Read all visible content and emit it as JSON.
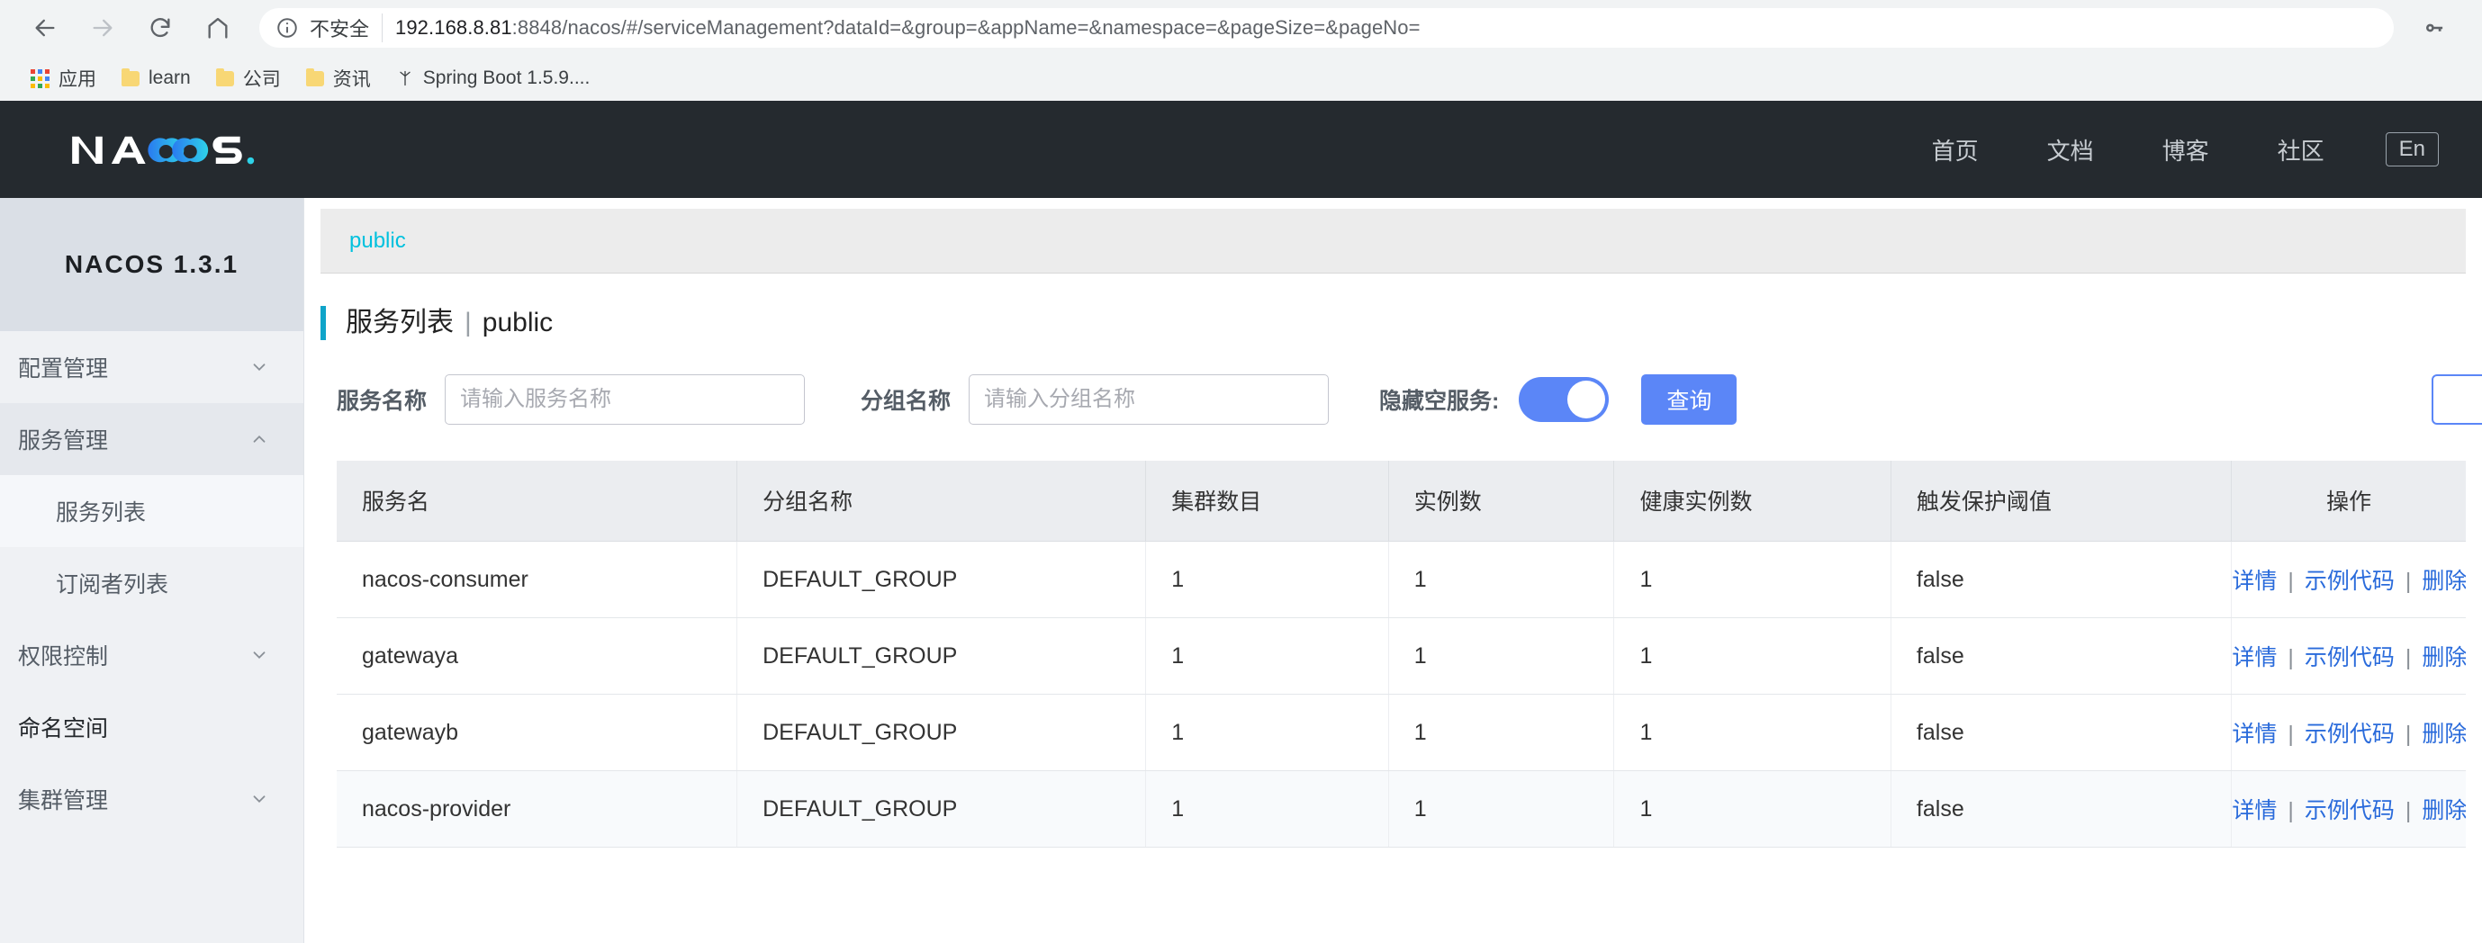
{
  "browser": {
    "back_icon": "back-arrow-icon",
    "forward_icon": "forward-arrow-icon",
    "reload_icon": "reload-icon",
    "home_icon": "home-icon",
    "info_icon": "info-circle-icon",
    "security_label": "不安全",
    "url_host": "192.168.8.81",
    "url_rest": ":8848/nacos/#/serviceManagement?dataId=&group=&appName=&namespace=&pageSize=&pageNo=",
    "key_icon": "key-icon",
    "bookmarks": [
      {
        "label": "应用",
        "icon": "apps-grid-icon"
      },
      {
        "label": "learn",
        "icon": "folder-icon"
      },
      {
        "label": "公司",
        "icon": "folder-icon"
      },
      {
        "label": "资讯",
        "icon": "folder-icon"
      },
      {
        "label": "Spring Boot 1.5.9....",
        "icon": "spring-leaf-icon"
      }
    ]
  },
  "header": {
    "logo_text": "NACOS.",
    "nav": [
      {
        "label": "首页"
      },
      {
        "label": "文档"
      },
      {
        "label": "博客"
      },
      {
        "label": "社区"
      }
    ],
    "lang_button": "En"
  },
  "sidebar": {
    "title": "NACOS 1.3.1",
    "items": [
      {
        "label": "配置管理",
        "expandable": true,
        "expanded": false,
        "chevron": "chevron-down-icon"
      },
      {
        "label": "服务管理",
        "expandable": true,
        "expanded": true,
        "chevron": "chevron-up-icon"
      },
      {
        "label": "权限控制",
        "expandable": true,
        "expanded": false,
        "chevron": "chevron-down-icon"
      },
      {
        "label": "命名空间",
        "expandable": false,
        "expanded": false,
        "chevron": ""
      },
      {
        "label": "集群管理",
        "expandable": true,
        "expanded": false,
        "chevron": "chevron-down-icon"
      }
    ],
    "sub_items": [
      {
        "label": "服务列表",
        "active": true
      },
      {
        "label": "订阅者列表",
        "active": false
      }
    ]
  },
  "main": {
    "breadcrumb": "public",
    "title": "服务列表",
    "title_sep": "|",
    "title_namespace": "public",
    "filters": {
      "service_name_label": "服务名称",
      "service_name_value": "",
      "service_name_placeholder": "请输入服务名称",
      "group_name_label": "分组名称",
      "group_name_value": "",
      "group_name_placeholder": "请输入分组名称",
      "hide_empty_label": "隐藏空服务:",
      "hide_empty_on": true,
      "query_button": "查询"
    },
    "table": {
      "columns": [
        "服务名",
        "分组名称",
        "集群数目",
        "实例数",
        "健康实例数",
        "触发保护阈值",
        "操作"
      ],
      "rows": [
        {
          "name": "nacos-consumer",
          "group": "DEFAULT_GROUP",
          "clusters": "1",
          "instances": "1",
          "healthy": "1",
          "protect": "false"
        },
        {
          "name": "gatewaya",
          "group": "DEFAULT_GROUP",
          "clusters": "1",
          "instances": "1",
          "healthy": "1",
          "protect": "false"
        },
        {
          "name": "gatewayb",
          "group": "DEFAULT_GROUP",
          "clusters": "1",
          "instances": "1",
          "healthy": "1",
          "protect": "false"
        },
        {
          "name": "nacos-provider",
          "group": "DEFAULT_GROUP",
          "clusters": "1",
          "instances": "1",
          "healthy": "1",
          "protect": "false"
        }
      ],
      "actions": {
        "detail": "详情",
        "sample_code": "示例代码",
        "delete": "删除",
        "separator": "|"
      }
    }
  },
  "colors": {
    "header_bg": "#252a2f",
    "accent_cyan": "#0fa4c9",
    "link_blue": "#2a6bdb",
    "primary_blue": "#5b86f7",
    "breadcrumb_cyan": "#00c1de",
    "sidebar_bg": "#eff1f4"
  }
}
